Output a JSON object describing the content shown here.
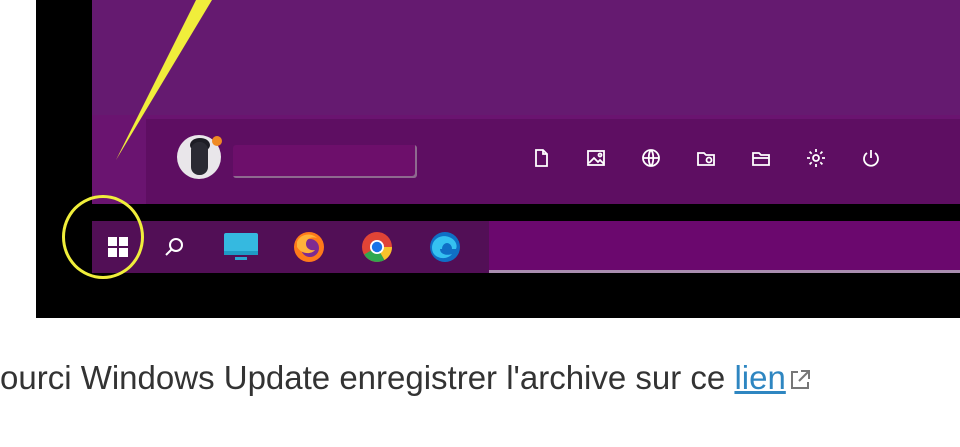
{
  "screenshot": {
    "quick_access_icons": [
      {
        "icon": "document-icon"
      },
      {
        "icon": "pictures-icon"
      },
      {
        "icon": "network-icon"
      },
      {
        "icon": "file-explorer-icon"
      },
      {
        "icon": "folder-icon"
      },
      {
        "icon": "settings-icon"
      },
      {
        "icon": "power-icon"
      }
    ],
    "taskbar": {
      "apps": [
        {
          "icon": "windows-start-icon"
        },
        {
          "icon": "search-icon"
        },
        {
          "icon": "monitor-app-icon"
        },
        {
          "icon": "firefox-icon"
        },
        {
          "icon": "chrome-icon"
        },
        {
          "icon": "edge-icon"
        }
      ]
    },
    "annotation_color": "#f0ee3b",
    "accent_purple": "#6a1470"
  },
  "caption": {
    "text": "ourci Windows Update enregistrer l'archive sur ce ",
    "link_text": "lien",
    "link_icon": "external-link-icon"
  }
}
